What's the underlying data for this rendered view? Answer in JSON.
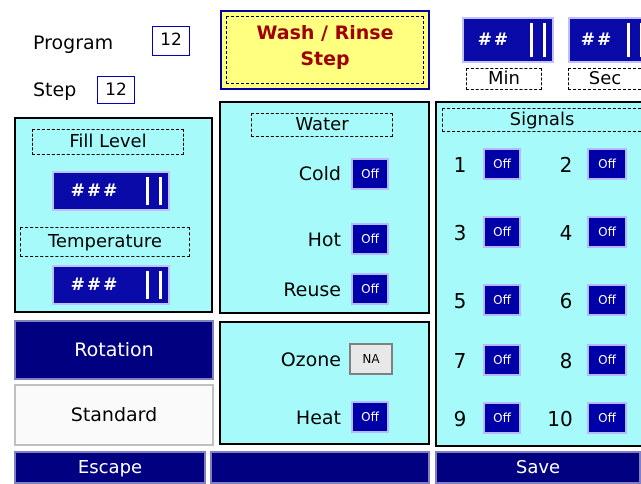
{
  "header": {
    "program_label": "Program",
    "program_value": "12",
    "step_label": "Step",
    "step_value": "12",
    "title_line1": "Wash / Rinse",
    "title_line2": "Step",
    "time_min_value": "##",
    "time_min_label": "Min",
    "time_sec_value": "##",
    "time_sec_label": "Sec"
  },
  "fill": {
    "fill_level_label": "Fill Level",
    "fill_level_value": "###",
    "temperature_label": "Temperature",
    "temperature_value": "###"
  },
  "rotation": {
    "rotation_label": "Rotation",
    "standard_label": "Standard"
  },
  "water": {
    "title": "Water",
    "cold_label": "Cold",
    "cold_state": "Off",
    "hot_label": "Hot",
    "hot_state": "Off",
    "reuse_label": "Reuse",
    "reuse_state": "Off"
  },
  "extras": {
    "ozone_label": "Ozone",
    "ozone_state": "NA",
    "heat_label": "Heat",
    "heat_state": "Off"
  },
  "signals": {
    "title": "Signals",
    "items": [
      {
        "num": "1",
        "state": "Off"
      },
      {
        "num": "2",
        "state": "Off"
      },
      {
        "num": "3",
        "state": "Off"
      },
      {
        "num": "4",
        "state": "Off"
      },
      {
        "num": "5",
        "state": "Off"
      },
      {
        "num": "6",
        "state": "Off"
      },
      {
        "num": "7",
        "state": "Off"
      },
      {
        "num": "8",
        "state": "Off"
      },
      {
        "num": "9",
        "state": "Off"
      },
      {
        "num": "10",
        "state": "Off"
      }
    ]
  },
  "footer": {
    "escape_label": "Escape",
    "middle_label": "",
    "save_label": "Save"
  },
  "colors": {
    "panel": "#a6fafa",
    "navy": "#000080",
    "title_bg": "#ffff80",
    "title_text": "#a00000"
  }
}
